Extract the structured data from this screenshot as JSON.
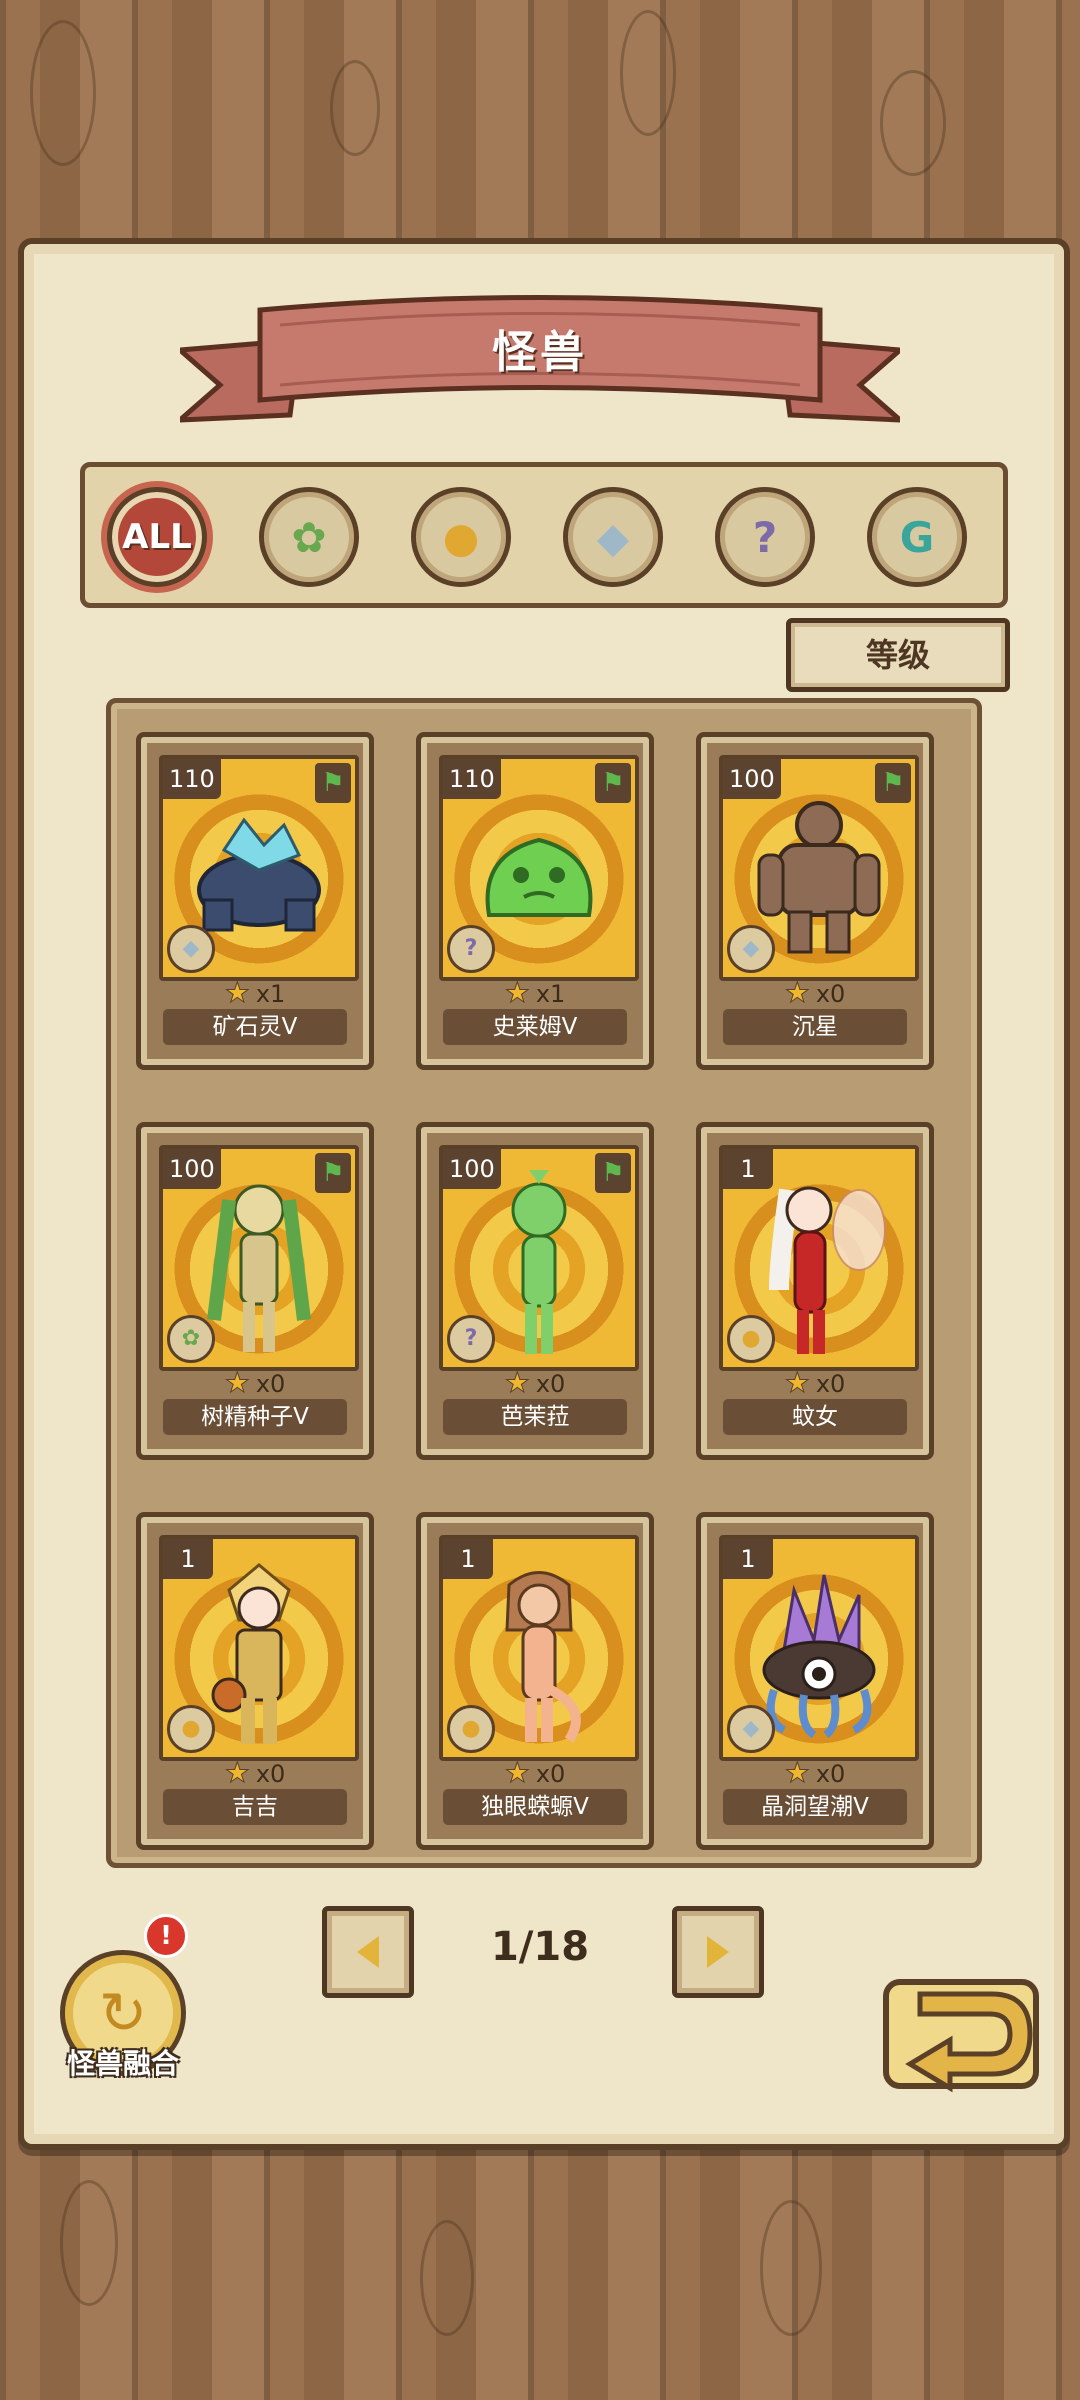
{
  "header": {
    "title": "怪兽"
  },
  "filters": [
    {
      "label": "ALL",
      "icon": "all-icon",
      "active": true
    },
    {
      "label": "",
      "icon": "leaf-icon",
      "active": false
    },
    {
      "label": "",
      "icon": "paw-icon",
      "active": false
    },
    {
      "label": "",
      "icon": "crystal-icon",
      "active": false
    },
    {
      "label": "",
      "icon": "question-icon",
      "active": false
    },
    {
      "label": "",
      "icon": "tool-icon",
      "active": false
    }
  ],
  "sort": {
    "label": "等级"
  },
  "cards": [
    {
      "level": "110",
      "flag": true,
      "type_icon": "crystal-icon",
      "stars": "x1",
      "name": "矿石灵V",
      "monster_icon": "golem-icon"
    },
    {
      "level": "110",
      "flag": true,
      "type_icon": "question-icon",
      "stars": "x1",
      "name": "史莱姆V",
      "monster_icon": "slime-icon"
    },
    {
      "level": "100",
      "flag": true,
      "type_icon": "crystal-icon",
      "stars": "x0",
      "name": "沉星",
      "monster_icon": "rock-giant-icon"
    },
    {
      "level": "100",
      "flag": true,
      "type_icon": "leaf-icon",
      "stars": "x0",
      "name": "树精种子V",
      "monster_icon": "dryad-icon"
    },
    {
      "level": "100",
      "flag": true,
      "type_icon": "question-icon",
      "stars": "x0",
      "name": "芭茉菈",
      "monster_icon": "plant-girl-icon"
    },
    {
      "level": "1",
      "flag": false,
      "type_icon": "paw-icon",
      "stars": "x0",
      "name": "蚊女",
      "monster_icon": "mosquito-girl-icon"
    },
    {
      "level": "1",
      "flag": false,
      "type_icon": "paw-icon",
      "stars": "x0",
      "name": "吉吉",
      "monster_icon": "boy-icon"
    },
    {
      "level": "1",
      "flag": false,
      "type_icon": "paw-icon",
      "stars": "x0",
      "name": "独眼蝾螈V",
      "monster_icon": "salamander-girl-icon"
    },
    {
      "level": "1",
      "flag": false,
      "type_icon": "crystal-icon",
      "stars": "x0",
      "name": "晶洞望潮V",
      "monster_icon": "crystal-octopus-icon"
    }
  ],
  "pagination": {
    "current": "1/18",
    "prev_icon": "arrow-left-icon",
    "next_icon": "arrow-right-icon"
  },
  "fusion": {
    "label": "怪兽融合",
    "badge": "!"
  },
  "back": {
    "icon": "return-arrow-icon"
  },
  "colors": {
    "accent_red": "#b3483a",
    "wood": "#9b7250",
    "parchment": "#efe5c9",
    "flag_green": "#5fb84e"
  }
}
